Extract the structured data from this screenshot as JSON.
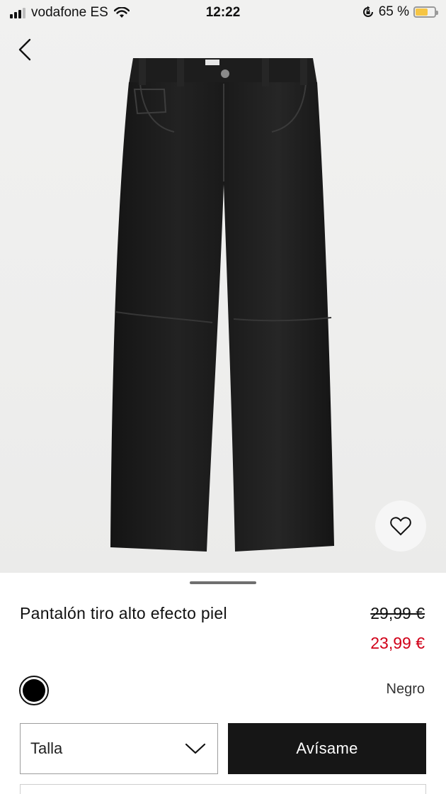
{
  "status_bar": {
    "carrier": "vodafone ES",
    "time": "12:22",
    "battery": "65 %",
    "battery_level": 0.65
  },
  "navigation": {
    "back_icon": "chevron-left-icon"
  },
  "product": {
    "name": "Pantalón tiro alto efecto piel",
    "price_original": "29,99 €",
    "price_sale": "23,99 €",
    "color_name": "Negro",
    "color_swatch": "#000000",
    "wishlist_icon": "heart-outline-icon"
  },
  "size_select": {
    "label": "Talla",
    "icon": "chevron-down-icon"
  },
  "actions": {
    "notify_label": "Avísame"
  },
  "colors": {
    "sale_price": "#d10018",
    "button_bg": "#161616",
    "battery": "#f6c544"
  }
}
